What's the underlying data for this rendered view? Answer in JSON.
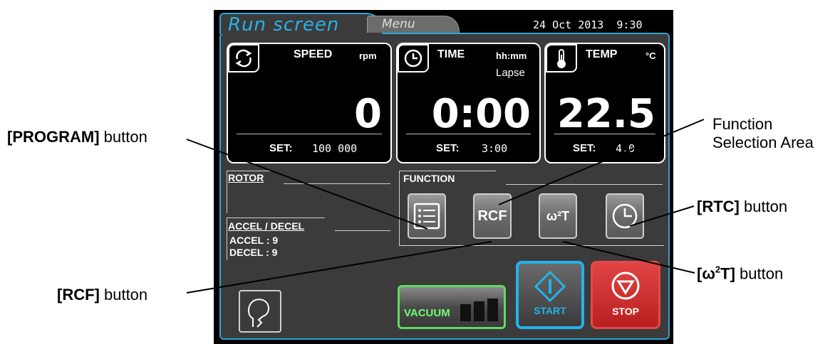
{
  "tabs": {
    "run": "Run screen",
    "menu": "Menu"
  },
  "datetime": {
    "date": "24 Oct 2013",
    "time": "9:30"
  },
  "speed": {
    "title": "SPEED",
    "unit": "rpm",
    "value": "0",
    "set_label": "SET:",
    "set_value": "100 000",
    "icon": "refresh-icon"
  },
  "time": {
    "title": "TIME",
    "unit": "hh:mm",
    "mode": "Lapse",
    "value": "0:00",
    "set_label": "SET:",
    "set_value": "3:00",
    "icon": "clock-icon"
  },
  "temp": {
    "title": "TEMP",
    "unit": "°C",
    "value": "22.5",
    "set_label": "SET:",
    "set_value": "4.0",
    "icon": "thermometer-icon"
  },
  "rotor": {
    "label": "ROTOR"
  },
  "accel_decel": {
    "label": "ACCEL / DECEL",
    "accel": "ACCEL :  9",
    "decel": "DECEL :  9"
  },
  "function": {
    "label": "FUNCTION",
    "buttons": [
      {
        "name": "program",
        "icon": "list-icon"
      },
      {
        "name": "rcf",
        "label": "RCF"
      },
      {
        "name": "w2t",
        "label": "ω²T"
      },
      {
        "name": "rtc",
        "icon": "clock-icon"
      }
    ]
  },
  "controls": {
    "vacuum": "VACUUM",
    "start": "START",
    "stop": "STOP"
  },
  "callouts": {
    "program": {
      "bold": "[PROGRAM]",
      "text": " button"
    },
    "function_area": {
      "line1": "Function",
      "line2": "Selection Area"
    },
    "rtc": {
      "bold": "[RTC]",
      "text": " button"
    },
    "w2t": {
      "bold_prefix": "[ω",
      "sup": "2",
      "bold_suffix": "T]",
      "text": " button"
    },
    "rcf": {
      "bold": "[RCF]",
      "text": " button"
    }
  },
  "colors": {
    "accent": "#2aa4d8",
    "start_border": "#21b4ec",
    "stop": "#d42d2d",
    "vacuum_border": "#5fdc5f",
    "panel": "#3b3b3b"
  }
}
